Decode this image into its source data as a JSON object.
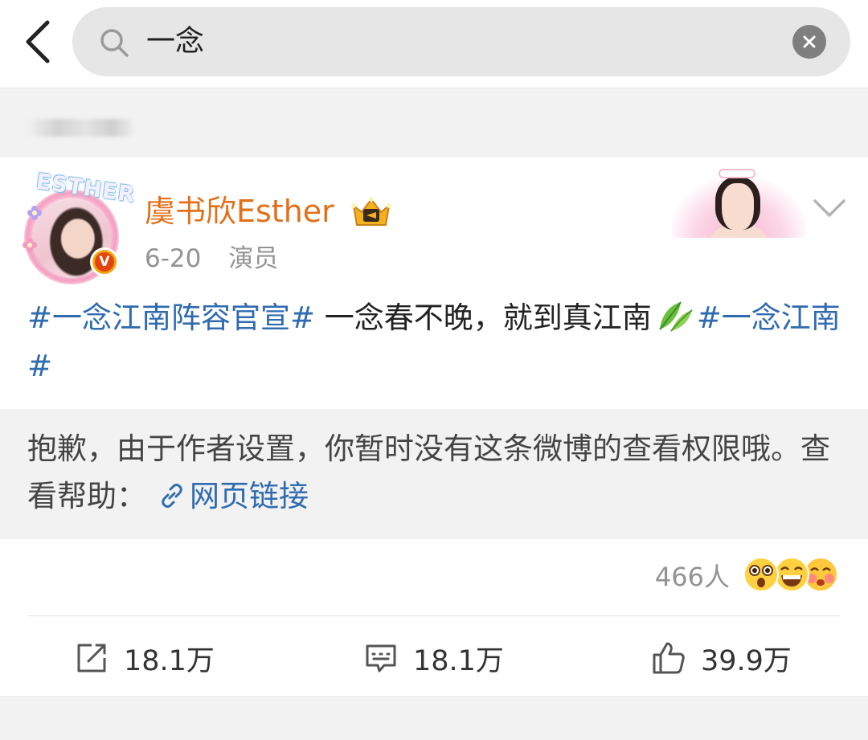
{
  "search": {
    "query": "一念"
  },
  "post": {
    "author": {
      "name": "虞书欣Esther",
      "frame_text": "ESTHER",
      "verified_label": "V"
    },
    "date": "6-20",
    "role": "演员",
    "content": {
      "topic1": "#一念江南阵容官宣#",
      "text": " 一念春不晚，就到真江南",
      "topic2": "#一念江南#"
    },
    "notice": {
      "text": "抱歉，由于作者设置，你暂时没有这条微博的查看权限哦。查看帮助：",
      "link_label": "网页链接"
    },
    "reactions": {
      "count": "466人",
      "emojis": [
        "shocked-emoji",
        "grin-emoji",
        "blush-emoji"
      ]
    },
    "actions": {
      "repost": "18.1万",
      "comment": "18.1万",
      "like": "39.9万"
    }
  },
  "colors": {
    "username": "#e2701b",
    "link": "#2f6bb0",
    "muted": "#939393",
    "background": "#f2f2f2"
  }
}
